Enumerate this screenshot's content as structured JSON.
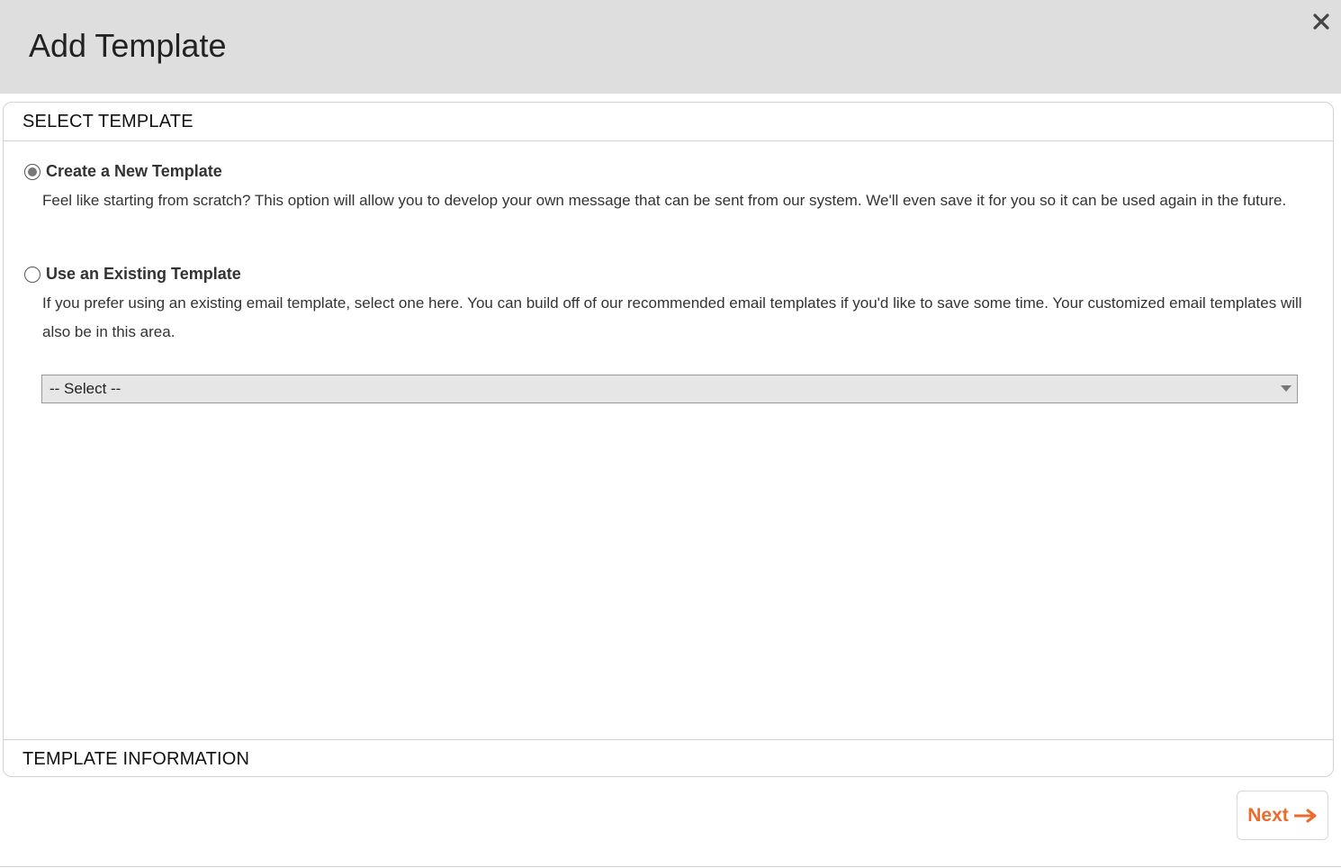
{
  "modal": {
    "title": "Add Template",
    "close_icon": "close-icon"
  },
  "sections": {
    "select_template": "SELECT TEMPLATE",
    "template_information": "TEMPLATE INFORMATION"
  },
  "options": [
    {
      "label": "Create a New Template",
      "description": "Feel like starting from scratch? This option will allow you to develop your own message that can be sent from our system. We'll even save it for you so it can be used again in the future.",
      "selected": true
    },
    {
      "label": "Use an Existing Template",
      "description": "If you prefer using an existing email template, select one here. You can build off of our recommended email templates if you'd like to save some time. Your customized email templates will also be in this area.",
      "selected": false
    }
  ],
  "template_select": {
    "selected_value": "-- Select --"
  },
  "footer": {
    "next_label": "Next",
    "next_icon": "arrow-right-icon"
  },
  "colors": {
    "header_bg": "#dedede",
    "accent": "#ec6a2c"
  }
}
